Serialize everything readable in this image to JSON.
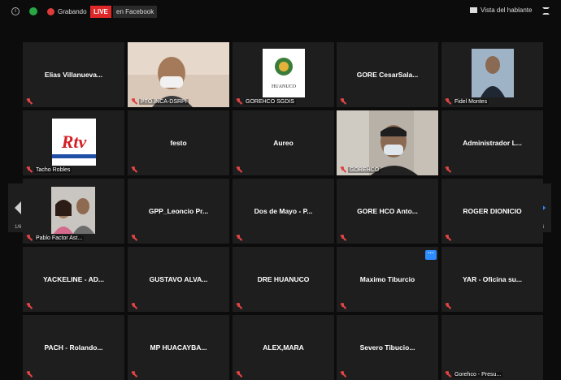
{
  "topbar": {
    "recording_label": "Grabando",
    "live_label": "LIVE",
    "facebook_label": "en Facebook",
    "view_label": "Vista del hablante"
  },
  "pagination": {
    "left": "1/6",
    "right": "1/6"
  },
  "participants": [
    {
      "name": "Elias Villanueva...",
      "label": ""
    },
    {
      "name": "",
      "label": "PTO.INCA-DSRPI",
      "video": "man-mask"
    },
    {
      "name": "",
      "label": "GOREHCO SGDIS",
      "video": "logo-huanuco",
      "logo_text": "HUANUCO"
    },
    {
      "name": "GORE CesarSala...",
      "label": ""
    },
    {
      "name": "",
      "label": "Fidel Montes",
      "video": "man-suit"
    },
    {
      "name": "",
      "label": "Tacho Robles",
      "video": "rtv-logo",
      "logo_text": "Rtv"
    },
    {
      "name": "festo",
      "label": ""
    },
    {
      "name": "Aureo",
      "label": ""
    },
    {
      "name": "",
      "label": "GOREHCO",
      "video": "man-mask-glasses"
    },
    {
      "name": "Administrador L...",
      "label": ""
    },
    {
      "name": "",
      "label": "Pablo Factor Ast...",
      "video": "couple"
    },
    {
      "name": "GPP_Leoncio Pr...",
      "label": ""
    },
    {
      "name": "Dos de Mayo - P...",
      "label": ""
    },
    {
      "name": "GORE HCO Anto...",
      "label": ""
    },
    {
      "name": "ROGER DIONICIO",
      "label": ""
    },
    {
      "name": "YACKELINE - AD...",
      "label": ""
    },
    {
      "name": "GUSTAVO ALVA...",
      "label": ""
    },
    {
      "name": "DRE HUANUCO",
      "label": ""
    },
    {
      "name": "Maximo Tiburcio",
      "label": "",
      "more_badge": "···"
    },
    {
      "name": "YAR - Oficina su...",
      "label": ""
    },
    {
      "name": "PACH - Rolando...",
      "label": ""
    },
    {
      "name": "MP HUACAYBA...",
      "label": ""
    },
    {
      "name": "ALEX,MARA",
      "label": ""
    },
    {
      "name": "Severo Tibucio...",
      "label": ""
    },
    {
      "name": "",
      "label": "Gorehco - Presu..."
    }
  ],
  "colors": {
    "tile_bg": "#1e1e1e",
    "active_border": "#c6e24a",
    "live_red": "#e02828",
    "mic_muted": "#e24444",
    "accent_blue": "#2d8cff"
  }
}
